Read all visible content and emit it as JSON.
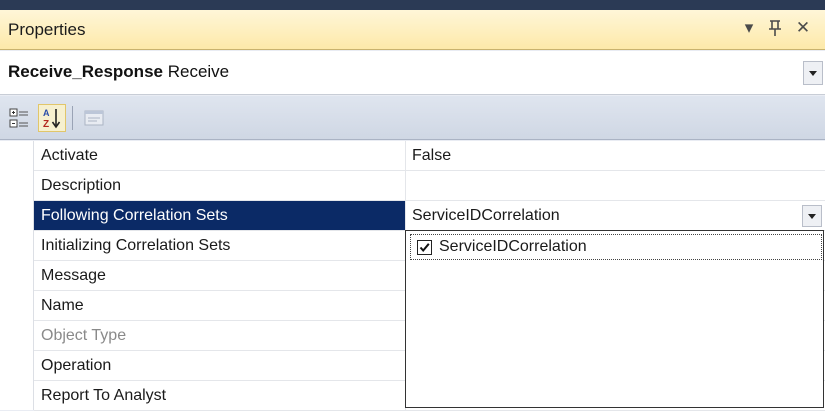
{
  "titlebar": {
    "title": "Properties",
    "buttons": [
      {
        "name": "window-position-icon",
        "glyph": "▾"
      },
      {
        "name": "pin-icon",
        "glyph": "ᵽ"
      },
      {
        "name": "close-icon",
        "glyph": "✕"
      }
    ]
  },
  "selector": {
    "object_name": "Receive_Response",
    "object_type": "Receive"
  },
  "toolbar": {
    "buttons": [
      {
        "name": "categorized-icon",
        "pressed": false,
        "enabled": true
      },
      {
        "name": "alphabetical-icon",
        "pressed": true,
        "enabled": true
      },
      {
        "name": "property-pages-icon",
        "pressed": false,
        "enabled": false
      }
    ]
  },
  "properties": [
    {
      "name": "Activate",
      "value": "False"
    },
    {
      "name": "Description",
      "value": ""
    },
    {
      "name": "Following Correlation Sets",
      "value": "ServiceIDCorrelation",
      "selected": true
    },
    {
      "name": "Initializing Correlation Sets",
      "value": ""
    },
    {
      "name": "Message",
      "value": ""
    },
    {
      "name": "Name",
      "value": ""
    },
    {
      "name": "Object Type",
      "value": "",
      "disabled": true
    },
    {
      "name": "Operation",
      "value": ""
    },
    {
      "name": "Report To Analyst",
      "value": ""
    }
  ],
  "dropdown": {
    "items": [
      {
        "label": "ServiceIDCorrelation",
        "checked": true
      }
    ]
  },
  "colors": {
    "selection": "#0b2a66",
    "titlebar": "#fde9a9"
  }
}
